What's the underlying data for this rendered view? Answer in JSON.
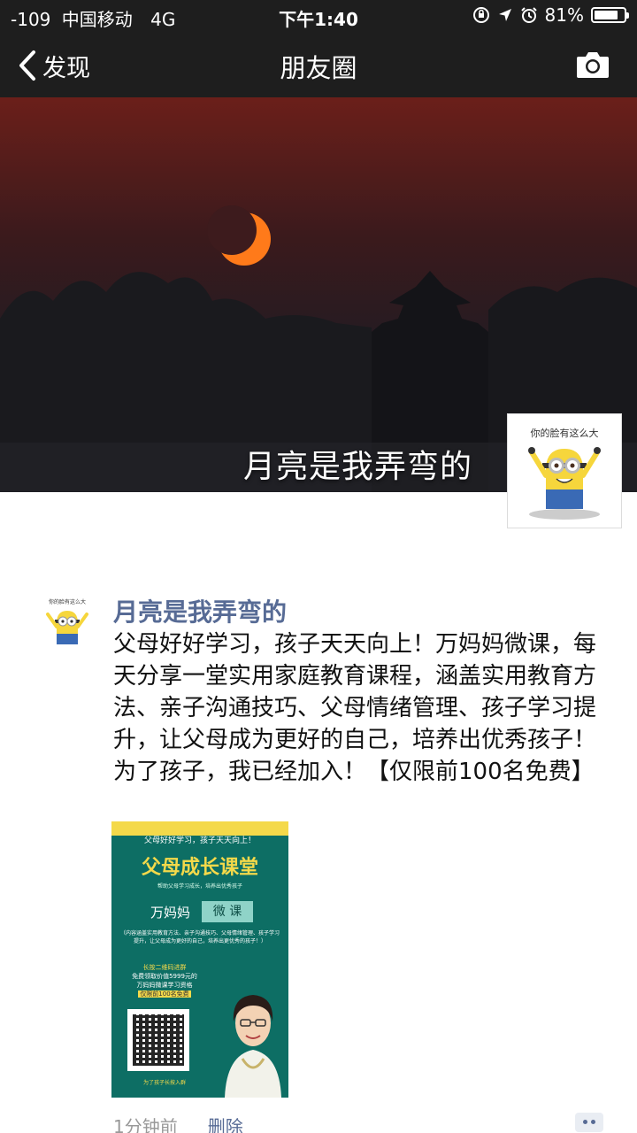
{
  "status_bar": {
    "signal": "-109",
    "carrier": "中国移动",
    "network": "4G",
    "time": "下午1:40",
    "battery_percent": "81%",
    "battery_level": 0.81
  },
  "nav": {
    "back_label": "发现",
    "title": "朋友圈",
    "camera_icon": "camera-icon"
  },
  "profile": {
    "cover_name": "月亮是我弄弯的",
    "avatar_caption": "你的脸有这么大"
  },
  "post": {
    "author": "月亮是我弄弯的",
    "text": "父母好好学习，孩子天天向上！万妈妈微课，每天分享一堂实用家庭教育课程，涵盖实用教育方法、亲子沟通技巧、父母情绪管理、孩子学习提升，让父母成为更好的自己，培养出优秀孩子！为了孩子，我已经加入！【仅限前100名免费】",
    "time_ago": "1分钟前",
    "delete_label": "删除",
    "comment_icon": "comment-icon",
    "poster": {
      "slogan": "父母好好学习，孩子天天向上！",
      "title": "父母成长课堂",
      "subtitle": "帮助父母学习成长，培养出优秀孩子",
      "brand": "万妈妈",
      "badge": "微 课",
      "description": "（内容涵盖实用教育方法、亲子沟通技巧、父母情绪管理、孩子学习提升，让父母成为更好的自己，培养出更优秀的孩子！）",
      "cta_line1": "长按二维码进群",
      "cta_line2": "免费领取价值5999元的",
      "cta_line3": "万妈妈微课学习资格",
      "cta_line4": "仅限前100名免费",
      "bottom_text": "为了孩子长按入群"
    }
  }
}
